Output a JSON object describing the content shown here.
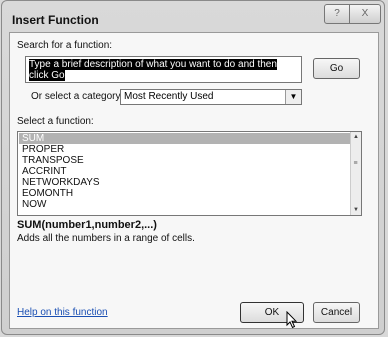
{
  "window": {
    "title": "Insert Function",
    "help_glyph": "?",
    "close_glyph": "X"
  },
  "search": {
    "label": "Search for a function:",
    "value": "Type a brief description of what you want to do and then click Go",
    "go_label": "Go"
  },
  "category": {
    "label": "Or select a category:",
    "selected": "Most Recently Used"
  },
  "functions": {
    "label": "Select a function:",
    "items": [
      "SUM",
      "PROPER",
      "TRANSPOSE",
      "ACCRINT",
      "NETWORKDAYS",
      "EOMONTH",
      "NOW"
    ],
    "selected_index": 0
  },
  "selected_function": {
    "signature": "SUM(number1,number2,...)",
    "description": "Adds all the numbers in a range of cells."
  },
  "footer": {
    "help_link": "Help on this function",
    "ok_label": "OK",
    "cancel_label": "Cancel"
  },
  "icons": {
    "dropdown": "chevron-down-icon",
    "pointer": "mouse-pointer-icon"
  }
}
